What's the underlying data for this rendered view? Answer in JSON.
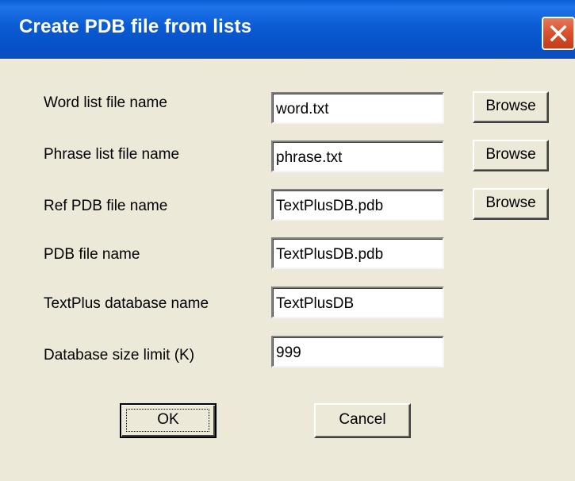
{
  "window": {
    "title": "Create PDB file from lists"
  },
  "fields": [
    {
      "label": "Word list file name",
      "value": "word.txt",
      "browse": "Browse"
    },
    {
      "label": "Phrase list file name",
      "value": "phrase.txt",
      "browse": "Browse"
    },
    {
      "label": "Ref PDB file name",
      "value": "TextPlusDB.pdb",
      "browse": "Browse"
    },
    {
      "label": "PDB file name",
      "value": "TextPlusDB.pdb"
    },
    {
      "label": "TextPlus database name",
      "value": "TextPlusDB"
    },
    {
      "label": "Database size limit (K)",
      "value": "999"
    }
  ],
  "buttons": {
    "ok": "OK",
    "cancel": "Cancel"
  }
}
